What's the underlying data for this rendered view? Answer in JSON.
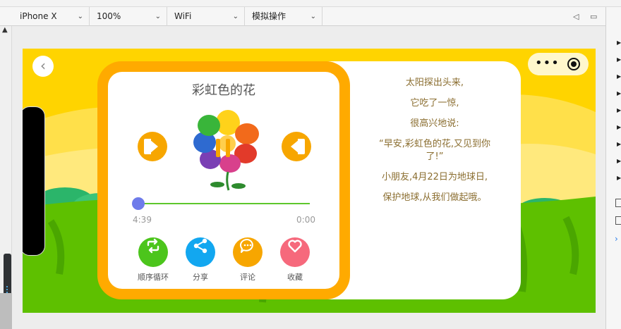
{
  "toolbar": {
    "device": "iPhone X",
    "zoom": "100%",
    "network": "WiFi",
    "mode": "模拟操作"
  },
  "player": {
    "title": "彩虹色的花",
    "elapsed": "4:39",
    "remaining": "0:00",
    "progress": 0.02,
    "actions": [
      {
        "label": "顺序循环",
        "icon": "loop-icon",
        "color": "#4cc51c"
      },
      {
        "label": "分享",
        "icon": "share-icon",
        "color": "#12a7f0"
      },
      {
        "label": "评论",
        "icon": "comment-icon",
        "color": "#f7a600"
      },
      {
        "label": "收藏",
        "icon": "heart-icon",
        "color": "#f6697c"
      }
    ]
  },
  "lyrics": [
    "太阳探出头来,",
    "它吃了一惊,",
    "很高兴地说:",
    "“早安,彩虹色的花,又见到你了!”",
    "小朋友,4月22日为地球日,",
    "保护地球,从我们做起哦。"
  ],
  "colors": {
    "background": "#ffd400",
    "card_border": "#ffaa00",
    "grass": "#5ec000",
    "lyrics_text": "#8a6d2f"
  }
}
